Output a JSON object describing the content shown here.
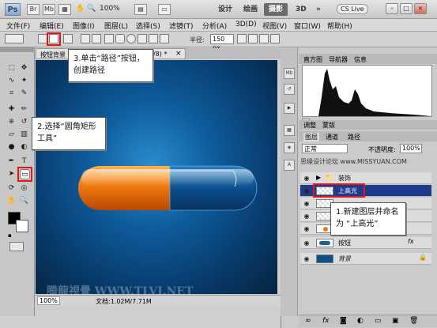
{
  "titlebar": {
    "app_logo": "Ps",
    "zoom": "100%",
    "workspaces": [
      "设计",
      "绘画",
      "摄影",
      "3D"
    ],
    "active_workspace": "摄影",
    "cs_live": "CS Live",
    "more": "»"
  },
  "menubar": {
    "items": [
      "文件(F)",
      "编辑(E)",
      "图像(I)",
      "图层(L)",
      "选择(S)",
      "滤镜(T)",
      "分析(A)",
      "3D(D)",
      "视图(V)",
      "窗口(W)",
      "帮助(H)"
    ]
  },
  "options": {
    "radius_label": "半径:",
    "radius_value": "150 px"
  },
  "document": {
    "tab_title": "按钮背景",
    "tab_suffix": "/8) *",
    "close": "×",
    "zoom": "100%",
    "doc_info": "文档:1.02M/7.71M",
    "watermark": "腾龍視覺 WWW.TLVI.NET"
  },
  "panels": {
    "histogram_tabs": [
      "直方图",
      "导航器",
      "信息"
    ],
    "adjust_tabs": [
      "调整",
      "蒙版"
    ],
    "layers_tabs": [
      "图层",
      "通道",
      "路径"
    ],
    "blend_mode": "正常",
    "opacity_label": "不透明度:",
    "opacity_value": "100%",
    "fill_watermark": "思缘设计论坛 www.MISSYUAN.COM",
    "fx": "fx"
  },
  "layers": [
    {
      "name": "装饰",
      "type": "group"
    },
    {
      "name": "上高光",
      "type": "layer",
      "selected": true
    },
    {
      "name": "",
      "type": "layer"
    },
    {
      "name": "",
      "type": "layer"
    },
    {
      "name": "",
      "type": "layer"
    },
    {
      "name": "按钮",
      "type": "layer"
    },
    {
      "name": "背景",
      "type": "background"
    }
  ],
  "callouts": {
    "step1": "1.新建图层并命名为 “上高光”",
    "step2": "2.选择“圆角矩形工具”",
    "step3": "3.单击“路径”按钮，创建路径"
  },
  "colors": {
    "highlight_red": "#e01818",
    "selected_layer": "#1f3a8c",
    "pill_orange": "#f07a12",
    "canvas_blue": "#0e5c9c"
  }
}
